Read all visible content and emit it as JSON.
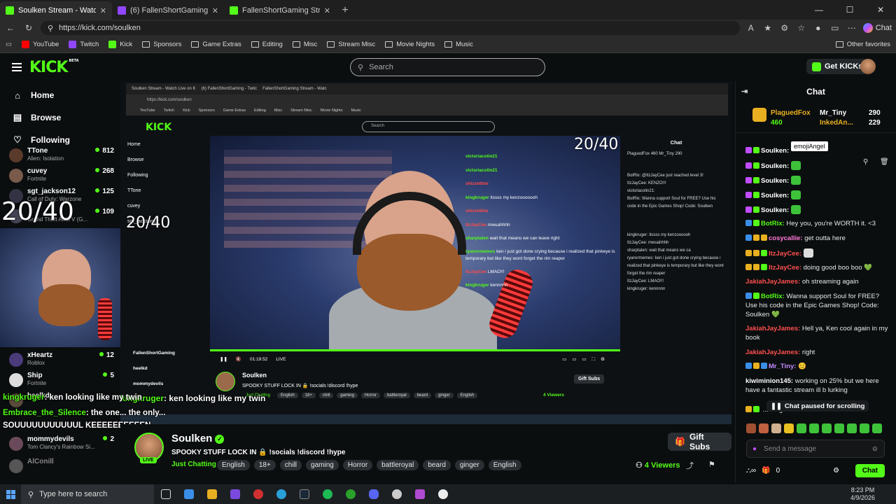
{
  "browser": {
    "tabs": [
      {
        "title": "Soulken Stream - Watch Live on Ki",
        "icon": "kick-icon"
      },
      {
        "title": "(6) FallenShortGaming - Twitc",
        "icon": "twitch-icon"
      },
      {
        "title": "FallenShortGaming Stream - Watc",
        "icon": "kick-icon"
      }
    ],
    "url": "https://kick.com/soulken",
    "chat_label": "Chat",
    "bookmarks": [
      "YouTube",
      "Twitch",
      "Kick",
      "Sponsors",
      "Game Extras",
      "Editing",
      "Misc",
      "Stream Misc",
      "Movie Nights",
      "Music"
    ],
    "other_favorites": "Other favorites"
  },
  "header": {
    "logo": "KICK",
    "logo_beta": "BETA",
    "search_placeholder": "Search",
    "get_kicks": "Get KICKs"
  },
  "sidebar": {
    "nav": [
      {
        "label": "Home",
        "icon": "home-icon"
      },
      {
        "label": "Browse",
        "icon": "browse-icon"
      },
      {
        "label": "Following",
        "icon": "heart-icon"
      }
    ],
    "channels": [
      {
        "name": "TTone",
        "game": "Alien: Isolation",
        "viewers": "812"
      },
      {
        "name": "cuvey",
        "game": "Fortnite",
        "viewers": "268"
      },
      {
        "name": "sgt_jackson12",
        "game": "Call of Duty: Warzone",
        "viewers": "125"
      },
      {
        "name": "",
        "game": "Grand Theft Auto V (G...",
        "viewers": "109"
      },
      {
        "name": "xHeartz",
        "game": "Roblox",
        "viewers": "12"
      },
      {
        "name": "Ship",
        "game": "Fortnite",
        "viewers": "5"
      },
      {
        "name": "heelkd",
        "game": "",
        "viewers": ""
      },
      {
        "name": "mommydevils",
        "game": "Tom Clancy's Rainbow Si...",
        "viewers": "2"
      },
      {
        "name": "AlConill",
        "game": "",
        "viewers": ""
      }
    ]
  },
  "stream_overlay": {
    "timer_big": "20/40",
    "timer_small": "20/40",
    "overlay_chat": [
      {
        "user": "kingkruger",
        "text": ": ken looking like my twin"
      },
      {
        "user": "Embrace_the_Silence",
        "text": ": the one... the only..."
      },
      {
        "user": "",
        "text": "SOUUUUUUUUUUUL KEEEEEEEEEEN"
      }
    ]
  },
  "inner": {
    "tabs": [
      "Soulken Stream - Watch Live on K",
      "(6) FallenShortGaming - Twitc",
      "FallenShortGaming Stream - Watc"
    ],
    "url": "https://kick.com/soulken",
    "bookmarks": [
      "YouTube",
      "Twitch",
      "Kick",
      "Sponsors",
      "Game Extras",
      "Editing",
      "Misc",
      "Stream Misc",
      "Movie Nights",
      "Music"
    ],
    "logo": "KICK",
    "search": "Search",
    "nav": [
      "Home",
      "Browse",
      "Following"
    ],
    "channels": [
      "TTone",
      "cuvey",
      "sgt_jackson12",
      "FallenShortGaming",
      "heelkd",
      "mommydevils"
    ],
    "chat_title": "Chat",
    "chat_lines": [
      "PlaguedFox 460  Mr_Tiny 290",
      "BotRix: @ItzJayCee just reached level 3!",
      "ItzJayCee: KENZO!!!",
      "victoriacolin21:",
      "BotRix: Wanna support Soul for FREE? Use his code in the Epic Games Shop! Code: Soulken",
      "kingkruger: itssss my kenzoooooh",
      "ItzJayCee: mwuahhhh",
      "sharptalen: wait that means we ca",
      "ryanvrmemes: ken i just got done crying because i realized that pinkeye is temporary but like they wont forget the rim reaper",
      "ItzJayCee: LMAO!!!",
      "kingkruger: kennnnn"
    ],
    "overlay_chat": [
      {
        "user": "victoriacolin21",
        "text": ""
      },
      {
        "user": "victoriacolin21",
        "text": ""
      },
      {
        "user": "shizzelbtw",
        "text": ""
      },
      {
        "user": "kingkruger",
        "text": "itssss my kenzooooooh"
      },
      {
        "user": "shizzelbtw",
        "text": ""
      },
      {
        "user": "ItzJayCee",
        "text": "mwuahhhh"
      },
      {
        "user": "sharptalen",
        "text": "wait that means we can leave right"
      },
      {
        "user": "ryanvrmemes",
        "text": "ken i just got done crying because i realized that pinkeye is temporary but like they wont forget the rim reaper"
      },
      {
        "user": "ItzJayCee",
        "text": "LMAO!!!"
      },
      {
        "user": "kingkruger",
        "text": "kennnnn"
      }
    ],
    "time": "01:19:52",
    "live": "LIVE",
    "streamer": "Soulken",
    "title": "SPOOKY STUFF LOCK IN 🔒 !socials !discord !hype",
    "category": "Just Chatting",
    "tags": [
      "English",
      "18+",
      "chill",
      "gaming",
      "Horror",
      "battleroyal",
      "beard",
      "ginger",
      "English"
    ],
    "gift": "Gift Subs",
    "viewers": "4 Viewers"
  },
  "stream_info": {
    "streamer": "Soulken",
    "live_badge": "LIVE",
    "title": "SPOOKY STUFF LOCK IN 🔒 !socials !discord !hype",
    "category": "Just Chatting",
    "tags": [
      "English",
      "18+",
      "chill",
      "gaming",
      "Horror",
      "battleroyal",
      "beard",
      "ginger",
      "English"
    ],
    "gift_subs": "Gift Subs",
    "viewers": "4 Viewers"
  },
  "chat": {
    "title": "Chat",
    "leaders": [
      {
        "name": "PlaguedFox",
        "value": "460"
      },
      {
        "name": "Mr_Tiny",
        "value": "290"
      },
      {
        "name": "InkedAn...",
        "value": "229"
      }
    ],
    "tooltip": "emojiAngel",
    "messages": [
      {
        "user": "Soulken:",
        "text": "",
        "color": "#53fc18"
      },
      {
        "user": "Soulken:",
        "text": "",
        "color": "#ffffff"
      },
      {
        "user": "Soulken:",
        "text": "",
        "color": "#ffffff"
      },
      {
        "user": "Soulken:",
        "text": "",
        "color": "#ffffff"
      },
      {
        "user": "Soulken:",
        "text": "",
        "color": "#ffffff"
      },
      {
        "user": "BotRix:",
        "text": "Hey you, you're WORTH it. <3",
        "color": "#53fc18"
      },
      {
        "user": "cosycallie:",
        "text": "get outta here",
        "color": "#ff7ad9"
      },
      {
        "user": "ItzJayCee:",
        "text": "",
        "color": "#ff4f4f"
      },
      {
        "user": "ItzJayCee:",
        "text": "doing good boo boo 💚",
        "color": "#ff4f4f"
      },
      {
        "user": "JakiahJayJames:",
        "text": "oh streaming again",
        "color": "#ff4f4f"
      },
      {
        "user": "BotRix:",
        "text": "Wanna support Soul for FREE? Use his code in the Epic Games Shop! Code: Soulken 💚",
        "color": "#53fc18"
      },
      {
        "user": "JakiahJayJames:",
        "text": "Hell ya, Ken cool again in my book",
        "color": "#ff4f4f"
      },
      {
        "user": "JakiahJayJames:",
        "text": "right",
        "color": "#ff4f4f"
      },
      {
        "user": "Mr_Tiny:",
        "text": "😊",
        "color": "#c38bff"
      },
      {
        "user": "kiwiminion145:",
        "text": "working on 25% but we here have a fantastic stream ill b lurking",
        "color": "#ffffff"
      },
      {
        "user": "",
        "text": "...ming for boo boo",
        "color": "#ffffff"
      }
    ],
    "paused": "Chat paused for scrolling",
    "send_placeholder": "Send a message",
    "points": "0",
    "send_button": "Chat"
  },
  "taskbar": {
    "search": "Type here to search",
    "time": "8:23 PM",
    "date": "4/9/2026"
  }
}
